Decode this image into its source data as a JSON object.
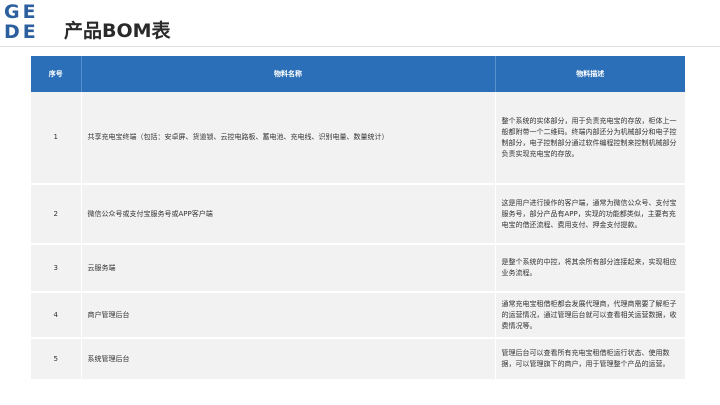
{
  "logo": {
    "line1": "GE",
    "line2": "DE",
    "color": "#2b5f9e"
  },
  "page_title": "产品BOM表",
  "table": {
    "headers": [
      "序号",
      "物料名称",
      "物料描述"
    ],
    "rows": [
      {
        "no": "1",
        "name": "共享充电宝终端（包括：安卓屏、货道锁、云控电路板、蓄电池、充电线、识别电量、数量统计）",
        "desc": "整个系统的实体部分，用于负责充电宝的存放，柜体上一般都附带一个二维码。终端内部还分为机械部分和电子控制部分，电子控制部分通过软件编程控制来控制机械部分负责实现充电宝的存放。"
      },
      {
        "no": "2",
        "name": "微信公众号或支付宝服务号或APP客户端",
        "desc": "这是用户进行操作的客户端，通常为微信公众号、支付宝服务号，部分产品有APP，实现的功能都类似，主要有充电宝的借还流程、费用支付、押金支付提款。"
      },
      {
        "no": "3",
        "name": "云服务端",
        "desc": "是整个系统的中控，将其余所有部分连接起来，实现相应业务流程。"
      },
      {
        "no": "4",
        "name": "商户管理后台",
        "desc": "通常充电宝租借柜都会发展代理商，代理商需要了解柜子的运营情况，通过管理后台就可以查看相关运营数据，收费情况等。"
      },
      {
        "no": "5",
        "name": "系统管理后台",
        "desc": "管理后台可以查看所有充电宝租借柜运行状态、使用数据，可以管理旗下的商户，用于管理整个产品的运营。"
      }
    ]
  },
  "colors": {
    "header_bg": "#2b6fb8",
    "row_bg": "#f2f2f2"
  }
}
